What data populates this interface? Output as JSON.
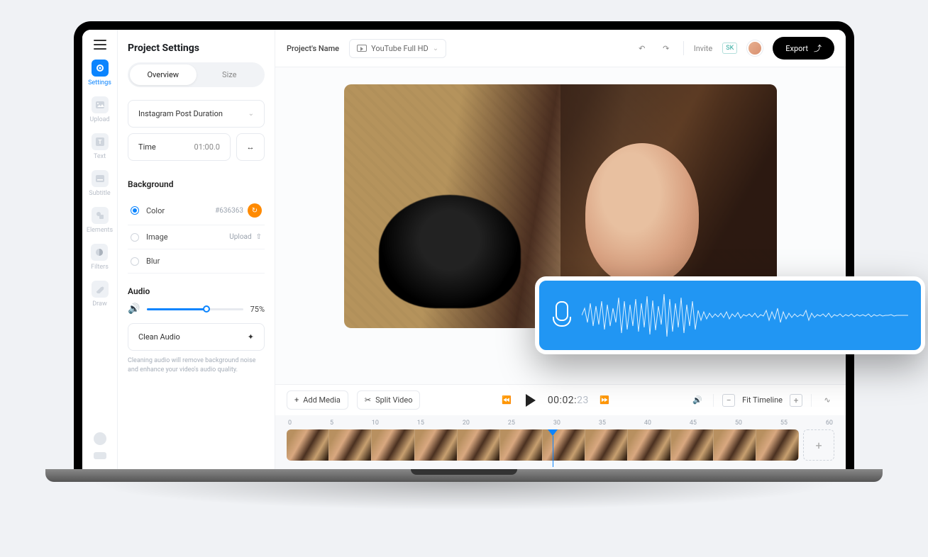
{
  "rail": {
    "items": [
      {
        "label": "Settings",
        "active": true
      },
      {
        "label": "Upload"
      },
      {
        "label": "Text"
      },
      {
        "label": "Subtitle"
      },
      {
        "label": "Elements"
      },
      {
        "label": "Filters"
      },
      {
        "label": "Draw"
      }
    ]
  },
  "panel": {
    "title": "Project Settings",
    "tabs": {
      "overview": "Overview",
      "size": "Size"
    },
    "duration_preset": "Instagram Post Duration",
    "time_label": "Time",
    "time_value": "01:00.0",
    "background_header": "Background",
    "bg_color_label": "Color",
    "bg_color_value": "#636363",
    "bg_image_label": "Image",
    "bg_image_action": "Upload",
    "bg_blur_label": "Blur",
    "audio_header": "Audio",
    "volume_pct": "75%",
    "clean_audio_label": "Clean Audio",
    "clean_audio_hint": "Cleaning audio will remove background noise and enhance your video's audio quality."
  },
  "topbar": {
    "project_name": "Project's Name",
    "preset": "YouTube Full HD",
    "invite": "Invite",
    "collaborator_badge": "SK",
    "export": "Export"
  },
  "controls": {
    "add_media": "Add Media",
    "split_video": "Split Video",
    "timecode_main": "00:02:",
    "timecode_faded": "23",
    "fit_timeline": "Fit Timeline"
  },
  "timeline": {
    "marks": [
      "0",
      "5",
      "10",
      "15",
      "20",
      "25",
      "30",
      "35",
      "40",
      "45",
      "50",
      "55",
      "60"
    ]
  }
}
